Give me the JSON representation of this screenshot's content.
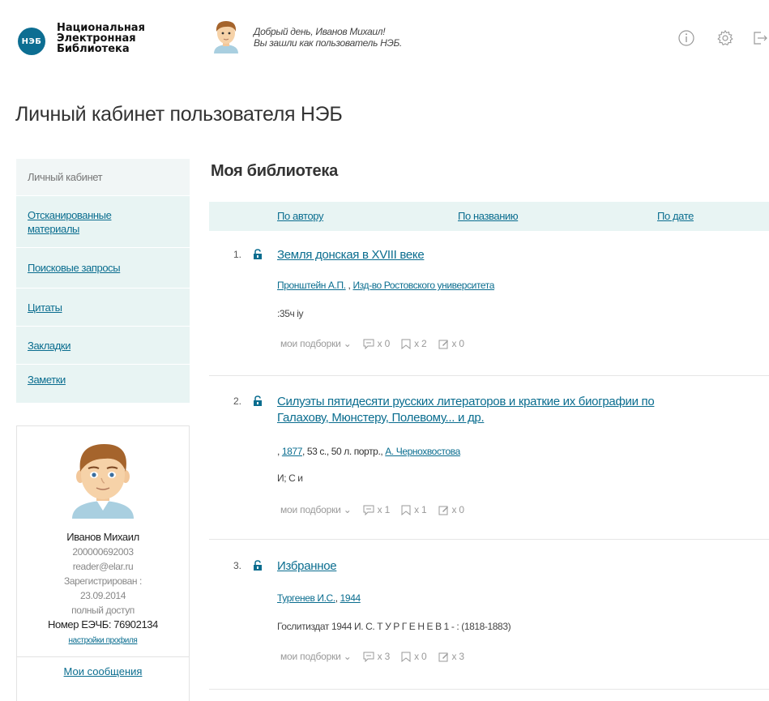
{
  "header": {
    "logo_short": "НЭБ",
    "logo_lines": [
      "Национальная",
      "Электронная",
      "Библиотека"
    ],
    "greeting_line1": "Добрый день, Иванов Михаил!",
    "greeting_line2": "Вы зашли как пользователь НЭБ."
  },
  "page_title": "Личный кабинет пользователя НЭБ",
  "sidebar": {
    "items": [
      {
        "label": "Личный кабинет"
      },
      {
        "label": "Отсканированные материалы"
      },
      {
        "label": "Поисковые запросы"
      },
      {
        "label": "Цитаты"
      },
      {
        "label": "Закладки"
      },
      {
        "label": "Заметки"
      }
    ]
  },
  "profile": {
    "name": "Иванов Михаил",
    "id": "200000692003",
    "email": "reader@elar.ru",
    "registered_label": "Зарегистрирован :",
    "registered_date": "23.09.2014",
    "access": "полный доступ",
    "card_number": "Номер ЕЭЧБ: 76902134",
    "settings_link": "настройки профиля",
    "messages_link": "Мои сообщения"
  },
  "library": {
    "title": "Моя библиотека",
    "sort": {
      "by_author": "По автору",
      "by_title": "По названию",
      "by_date": "По дате"
    },
    "items": [
      {
        "num": "1.",
        "title": "Земля донская в XVIII веке",
        "title2": "",
        "meta_prefix": "",
        "meta_link1": "Пронштейн А.П.",
        "meta_mid": " , ",
        "meta_link2": "Изд-во Ростовского университета",
        "meta_suffix": "",
        "desc": ":35ч iy",
        "collections": "мои подборки",
        "comments": "x 0",
        "bookmarks": "x 2",
        "notes": "x 0"
      },
      {
        "num": "2.",
        "title": "Силуэты пятидесяти русских литераторов и краткие их биографии по",
        "title2": "Галахову, Мюнстеру, Полевому... и др.",
        "meta_prefix": ", ",
        "meta_link1": "1877",
        "meta_mid": ", 53 с., 50 л. портр., ",
        "meta_link2": "А. Чернохвостова",
        "meta_suffix": "",
        "desc": "И; С и",
        "collections": "мои подборки",
        "comments": "x 1",
        "bookmarks": "x 1",
        "notes": "x 0"
      },
      {
        "num": "3.",
        "title": "Избранное",
        "title2": "",
        "meta_prefix": "",
        "meta_link1": "Тургенев И.С.",
        "meta_mid": ", ",
        "meta_link2": "1944",
        "meta_suffix": "",
        "desc": "Гослитиздат 1944 И. С. Т У Р Г Е Н Е В 1 - : (1818-1883)",
        "collections": "мои подборки",
        "comments": "x 3",
        "bookmarks": "x 0",
        "notes": "x 3"
      }
    ]
  },
  "colors": {
    "accent": "#0a6d8f",
    "logo": "#0d6e92",
    "sidebar_bg": "#e8f4f3"
  }
}
